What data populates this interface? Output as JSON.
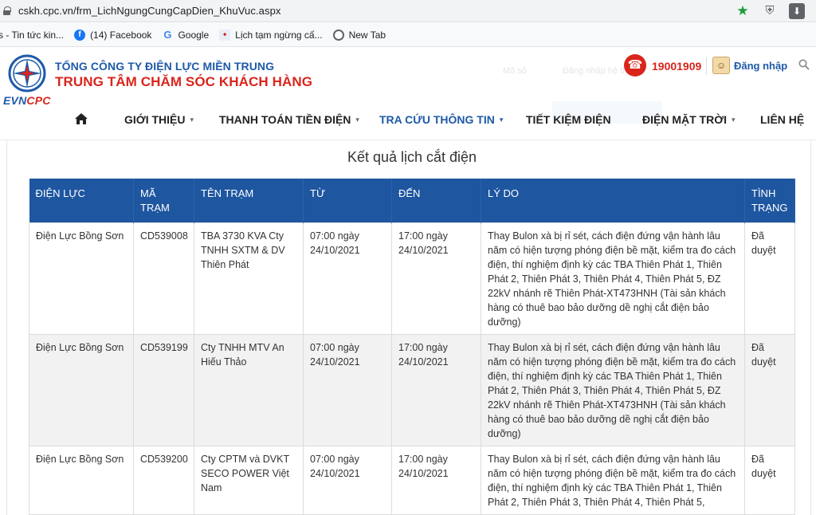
{
  "browser": {
    "url": "cskh.cpc.vn/frm_LichNgungCungCapDien_KhuVuc.aspx",
    "bookmarks": [
      {
        "label": "s - Tin tức kin...",
        "icon": "none"
      },
      {
        "label": "(14) Facebook",
        "icon": "facebook-icon"
      },
      {
        "label": "Google",
        "icon": "google-icon"
      },
      {
        "label": "Lịch tạm ngừng cấ...",
        "icon": "evn-icon"
      },
      {
        "label": "New Tab",
        "icon": "globe-icon"
      }
    ]
  },
  "header": {
    "org_line1": "TỔNG CÔNG TY ĐIỆN LỰC MIỀN TRUNG",
    "org_line2": "TRUNG TÂM CHĂM SÓC KHÁCH HÀNG",
    "logo_evn": "EVN",
    "logo_cpc": "CPC",
    "hotline": "19001909",
    "login": "Đăng nhập",
    "ghost_text1": "Mã số",
    "ghost_text2": "Đăng nhập hệ thống"
  },
  "nav": {
    "items": [
      {
        "label": "GIỚI THIỆU",
        "dropdown": true
      },
      {
        "label": "THANH TOÁN TIỀN ĐIỆN",
        "dropdown": true
      },
      {
        "label": "TRA CỨU THÔNG TIN",
        "dropdown": true,
        "active": true
      },
      {
        "label": "TIẾT KIỆM ĐIỆN",
        "dropdown": false
      },
      {
        "label": "ĐIỆN MẶT TRỜI",
        "dropdown": true
      },
      {
        "label": "LIÊN HỆ",
        "dropdown": false
      }
    ]
  },
  "main": {
    "title": "Kết quả lịch cắt điện",
    "columns": [
      "ĐIỆN LỰC",
      "MÃ TRẠM",
      "TÊN TRẠM",
      "TỪ",
      "ĐẾN",
      "LÝ DO",
      "TÌNH TRẠNG"
    ],
    "rows": [
      {
        "dien_luc": "Điện Lực Bồng Sơn",
        "ma_tram": "CD539008",
        "ten_tram": "TBA 3730 KVA Cty TNHH SXTM & DV Thiên Phát",
        "tu": "07:00 ngày 24/10/2021",
        "den": "17:00 ngày 24/10/2021",
        "ly_do": "Thay Bulon xà bị rỉ sét, cách điện đứng vận hành lâu năm có hiện tượng phóng điện bề mặt, kiểm tra đo cách điện, thí nghiệm định kỳ các TBA Thiên Phát 1, Thiên Phát 2, Thiên Phát 3, Thiên Phát 4, Thiên Phát 5, ĐZ 22kV nhánh rẽ Thiên Phát-XT473HNH (Tài sản khách hàng có thuê bao bảo dưỡng dề nghị cắt điện bảo dưỡng)",
        "tinh_trang": "Đã duyệt"
      },
      {
        "dien_luc": "Điện Lực Bồng Sơn",
        "ma_tram": "CD539199",
        "ten_tram": "Cty TNHH MTV An Hiếu Thảo",
        "tu": "07:00 ngày 24/10/2021",
        "den": "17:00 ngày 24/10/2021",
        "ly_do": "Thay Bulon xà bị rỉ sét, cách điện đứng vận hành lâu năm có hiện tượng phóng điện bề mặt, kiểm tra đo cách điện, thí nghiệm định kỳ các TBA Thiên Phát 1, Thiên Phát 2, Thiên Phát 3, Thiên Phát 4, Thiên Phát 5, ĐZ 22kV nhánh rẽ Thiên Phát-XT473HNH (Tài sản khách hàng có thuê bao bảo dưỡng dề nghị cắt điện bảo dưỡng)",
        "tinh_trang": "Đã duyệt"
      },
      {
        "dien_luc": "Điện Lực Bồng Sơn",
        "ma_tram": "CD539200",
        "ten_tram": "Cty CPTM và DVKT SECO POWER Việt Nam",
        "tu": "07:00 ngày 24/10/2021",
        "den": "17:00 ngày 24/10/2021",
        "ly_do": "Thay Bulon xà bị rỉ sét, cách điện đứng vận hành lâu năm có hiện tượng phóng điện bề mặt, kiểm tra đo cách điện, thí nghiệm định kỳ các TBA Thiên Phát 1, Thiên Phát 2, Thiên Phát 3, Thiên Phát 4, Thiên Phát 5,",
        "tinh_trang": "Đã duyệt"
      }
    ]
  },
  "colors": {
    "brand_blue": "#1e5aa8",
    "brand_red": "#d9251c",
    "table_header": "#1e56a0"
  }
}
